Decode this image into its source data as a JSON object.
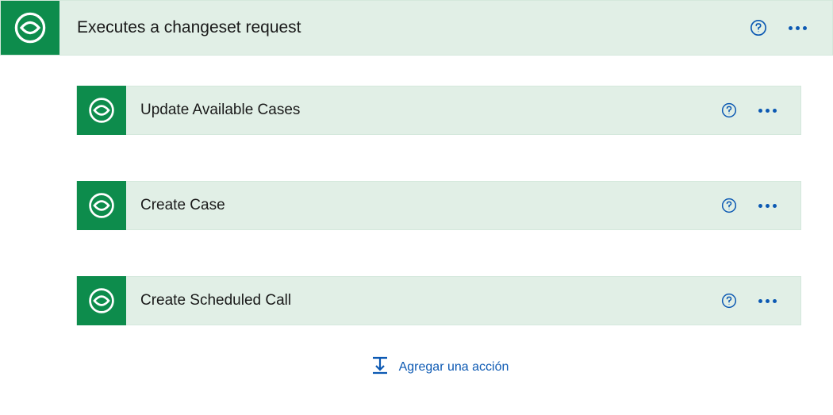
{
  "main": {
    "title": "Executes a changeset request"
  },
  "steps": [
    {
      "title": "Update Available Cases"
    },
    {
      "title": "Create Case"
    },
    {
      "title": "Create Scheduled Call"
    }
  ],
  "addAction": {
    "label": "Agregar una acción"
  },
  "colors": {
    "brandGreen": "#0d8c4c",
    "paleGreen": "#e1efe6",
    "linkBlue": "#0c59b3"
  }
}
